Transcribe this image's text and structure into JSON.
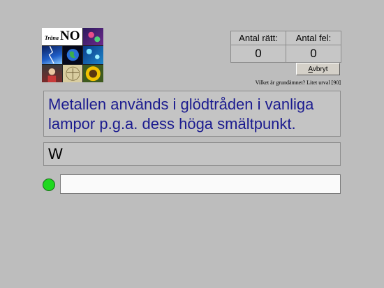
{
  "logo": {
    "small_text": "Träna",
    "big_text": "NO",
    "tiles": [
      "science-photo-icon",
      "lightning-icon",
      "earth-icon",
      "molecules-icon",
      "person-icon",
      "vitruvian-man-icon",
      "sunflower-icon"
    ]
  },
  "counters": {
    "correct_label": "Antal rätt:",
    "correct_value": "0",
    "wrong_label": "Antal fel:",
    "wrong_value": "0"
  },
  "abort_button": {
    "label": "Avbryt",
    "underline_letter": "A"
  },
  "subject_text": "Vilket är grundämnet? Litet urval [90]",
  "question": "Metallen används i glödtråden i vanliga lampor p.g.a. dess höga smältpunkt.",
  "answer_shown": "W",
  "answer_input": {
    "value": "",
    "placeholder": ""
  },
  "colors": {
    "background": "#bdbdbd",
    "question_text": "#1b1b8f",
    "status_dot": "#1fd81f"
  }
}
